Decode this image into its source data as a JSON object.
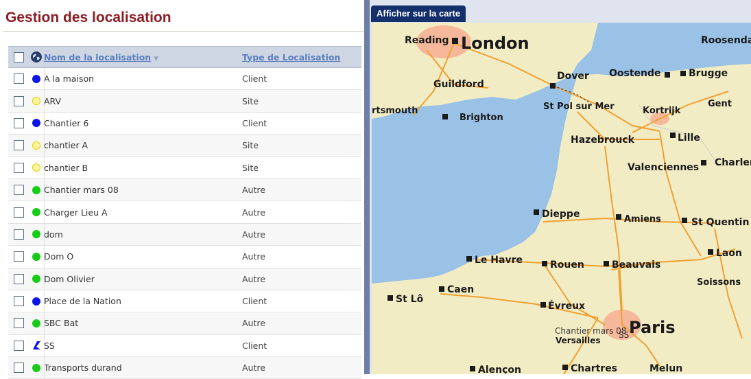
{
  "page": {
    "title": "Gestion des localisation"
  },
  "table": {
    "headers": {
      "name": "Nom de la localisation",
      "type": "Type de Localisation"
    },
    "rows": [
      {
        "name": "A la maison",
        "type": "Client",
        "icon": "blue-dot-icon"
      },
      {
        "name": "ARV",
        "type": "Site",
        "icon": "yellow-dot-icon"
      },
      {
        "name": "Chantier 6",
        "type": "Client",
        "icon": "blue-dot-icon"
      },
      {
        "name": "chantier A",
        "type": "Site",
        "icon": "yellow-dot-icon"
      },
      {
        "name": "chantier B",
        "type": "Site",
        "icon": "yellow-dot-icon"
      },
      {
        "name": "Chantier mars 08",
        "type": "Autre",
        "icon": "green-dot-icon"
      },
      {
        "name": "Charger Lieu A",
        "type": "Autre",
        "icon": "green-dot-icon"
      },
      {
        "name": "dom",
        "type": "Autre",
        "icon": "green-dot-icon"
      },
      {
        "name": "Dom O",
        "type": "Autre",
        "icon": "green-dot-icon"
      },
      {
        "name": "Dom Olivier",
        "type": "Autre",
        "icon": "green-dot-icon"
      },
      {
        "name": "Place de la Nation",
        "type": "Client",
        "icon": "blue-dot-icon"
      },
      {
        "name": "SBC Bat",
        "type": "Autre",
        "icon": "green-dot-icon"
      },
      {
        "name": "SS",
        "type": "Client",
        "icon": "blue-polygon-icon"
      },
      {
        "name": "Transports durand",
        "type": "Autre",
        "icon": "green-dot-icon"
      }
    ]
  },
  "map": {
    "tab_label": "Afficher sur la carte",
    "labels": {
      "reading": "Reading",
      "london": "London",
      "roosendaal": "Roosenda",
      "guildford": "Guildford",
      "dover": "Dover",
      "oostende": "Oostende",
      "brugge": "Brugge",
      "portsmouth": "rtsmouth",
      "brighton": "Brighton",
      "stpol": "St Pol sur Mer",
      "kortrijk": "Kortrijk",
      "gent": "Gent",
      "hazebrouck": "Hazebrouck",
      "lille": "Lille",
      "valenciennes": "Valenciennes",
      "charleroi": "Charler",
      "dieppe": "Dieppe",
      "amiens": "Amiens",
      "stquentin": "St Quentin",
      "lehavre": "Le Havre",
      "rouen": "Rouen",
      "beauvais": "Beauvais",
      "laon": "Laon",
      "soissons": "Soissons",
      "stlo": "St Lô",
      "caen": "Caen",
      "evreux": "Évreux",
      "paris": "Paris",
      "chantier": "Chantier mars 08",
      "ss": "SS",
      "versailles": "Versailles",
      "alencon": "Alençon",
      "chartres": "Chartres",
      "melun": "Melun"
    }
  },
  "colors": {
    "title": "#8b1e24",
    "header_link": "#5a7fbf",
    "divider": "#6d7fa6",
    "sea": "#9ac2e6",
    "land": "#f2ecc5",
    "urban": "#f5b89a",
    "road": "#f0a030"
  }
}
